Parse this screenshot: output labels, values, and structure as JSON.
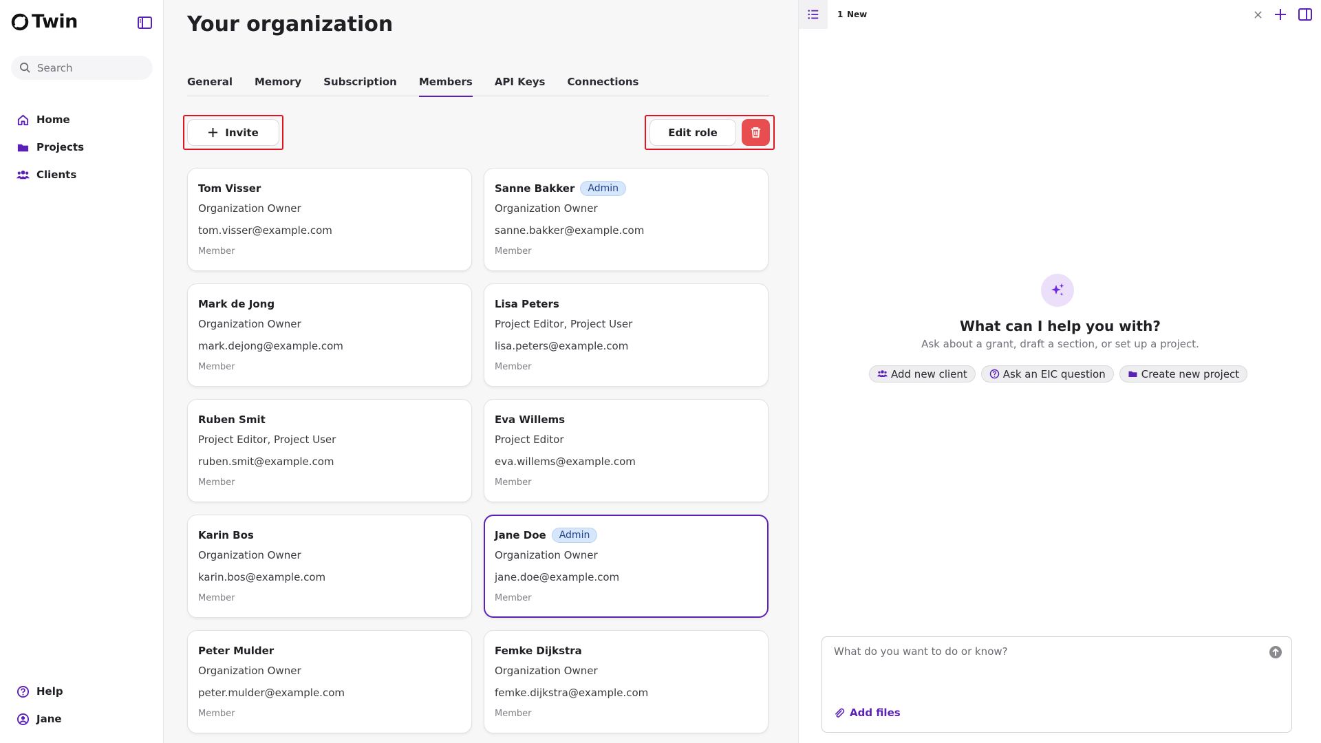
{
  "app": {
    "logo_text": "Twin"
  },
  "colors": {
    "accent": "#5b21b6",
    "danger": "#e84d4f",
    "badge_bg": "#d7e7fb",
    "highlight": "#e3141f"
  },
  "search": {
    "placeholder": "Search"
  },
  "sidebar": {
    "items": [
      {
        "label": "Home",
        "icon": "home-icon"
      },
      {
        "label": "Projects",
        "icon": "folder-icon"
      },
      {
        "label": "Clients",
        "icon": "users-icon"
      }
    ],
    "bottom": [
      {
        "label": "Help",
        "icon": "help-circle-icon"
      },
      {
        "label": "Jane",
        "icon": "user-circle-icon"
      }
    ]
  },
  "main": {
    "title": "Your organization",
    "tabs": [
      "General",
      "Memory",
      "Subscription",
      "Members",
      "API Keys",
      "Connections"
    ],
    "active_tab": "Members",
    "invite_label": "Invite",
    "edit_role_label": "Edit role"
  },
  "members": [
    {
      "name": "Tom Visser",
      "badge": "",
      "role": "Organization Owner",
      "email": "tom.visser@example.com",
      "type": "Member"
    },
    {
      "name": "Sanne Bakker",
      "badge": "Admin",
      "role": "Organization Owner",
      "email": "sanne.bakker@example.com",
      "type": "Member"
    },
    {
      "name": "Mark de Jong",
      "badge": "",
      "role": "Organization Owner",
      "email": "mark.dejong@example.com",
      "type": "Member"
    },
    {
      "name": "Lisa Peters",
      "badge": "",
      "role": "Project Editor, Project User",
      "email": "lisa.peters@example.com",
      "type": "Member"
    },
    {
      "name": "Ruben Smit",
      "badge": "",
      "role": "Project Editor, Project User",
      "email": "ruben.smit@example.com",
      "type": "Member"
    },
    {
      "name": "Eva Willems",
      "badge": "",
      "role": "Project Editor",
      "email": "eva.willems@example.com",
      "type": "Member"
    },
    {
      "name": "Karin Bos",
      "badge": "",
      "role": "Organization Owner",
      "email": "karin.bos@example.com",
      "type": "Member"
    },
    {
      "name": "Jane Doe",
      "badge": "Admin",
      "role": "Organization Owner",
      "email": "jane.doe@example.com",
      "type": "Member",
      "selected": true
    },
    {
      "name": "Peter Mulder",
      "badge": "",
      "role": "Organization Owner",
      "email": "peter.mulder@example.com",
      "type": "Member"
    },
    {
      "name": "Femke Dijkstra",
      "badge": "",
      "role": "Organization Owner",
      "email": "femke.dijkstra@example.com",
      "type": "Member"
    }
  ],
  "assistant": {
    "tab_number": "1",
    "tab_label": "New",
    "title": "What can I help you with?",
    "subtitle": "Ask about a grant, draft a section, or set up a project.",
    "chips": [
      {
        "label": "Add new client",
        "icon": "users-icon"
      },
      {
        "label": "Ask an EIC question",
        "icon": "question-circle-icon"
      },
      {
        "label": "Create new project",
        "icon": "folder-icon"
      }
    ],
    "input_placeholder": "What do you want to do or know?",
    "add_files_label": "Add files"
  }
}
